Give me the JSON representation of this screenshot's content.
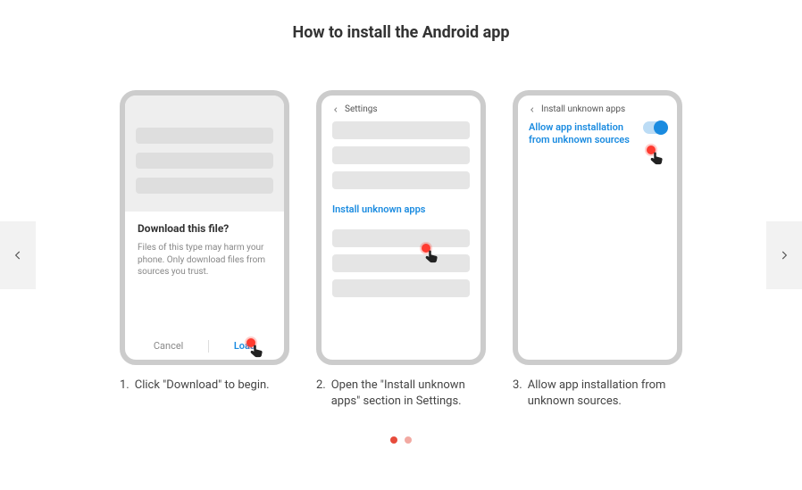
{
  "title": "How to install the Android app",
  "cards": [
    {
      "num": "1.",
      "caption": "Click \"Download\" to begin.",
      "dialog": {
        "title": "Download this file?",
        "body": "Files of this type may harm your phone. Only download files from sources you trust.",
        "cancel": "Cancel",
        "confirm": "Load"
      }
    },
    {
      "num": "2.",
      "caption": "Open the \"Install unknown apps\" section in Settings.",
      "header": "Settings",
      "link": "Install unknown apps"
    },
    {
      "num": "3.",
      "caption": "Allow app installation from unknown sources.",
      "header": "Install unknown apps",
      "toggle_label": "Allow app installation from unknown sources"
    }
  ],
  "pager": {
    "total": 2,
    "active_index": 0
  }
}
